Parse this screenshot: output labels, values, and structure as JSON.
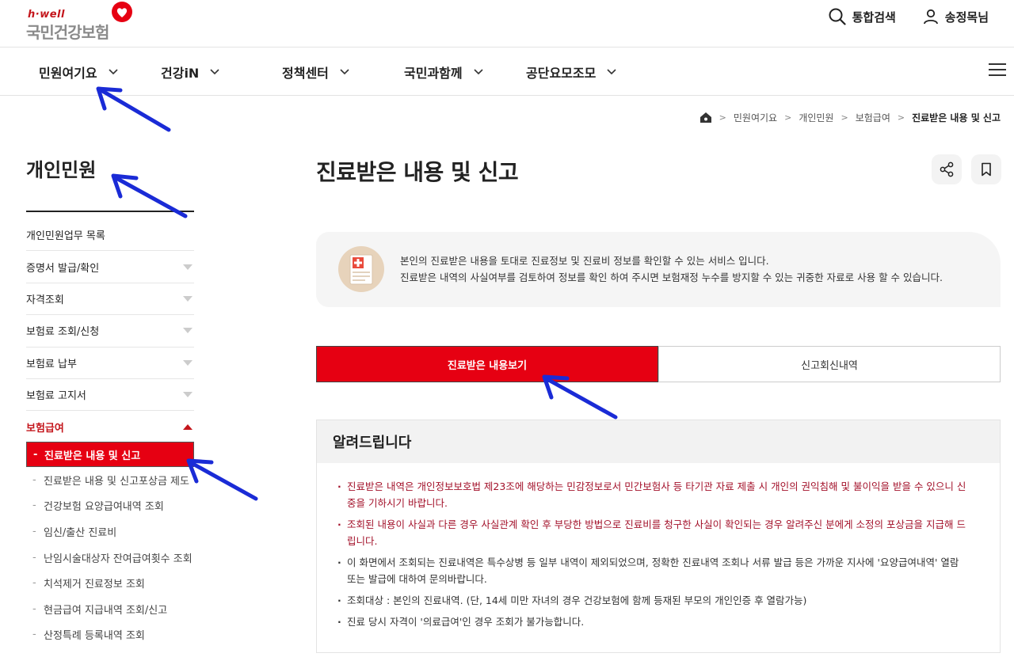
{
  "header": {
    "logo_small": "h·well",
    "logo_main": "국민건강보험",
    "search_label": "통합검색",
    "user_label": "송정목님"
  },
  "nav": {
    "items": [
      {
        "label": "민원여기요"
      },
      {
        "label": "건강iN"
      },
      {
        "label": "정책센터"
      },
      {
        "label": "국민과함께"
      },
      {
        "label": "공단요모조모"
      }
    ]
  },
  "breadcrumb": {
    "items": [
      "민원여기요",
      "개인민원",
      "보험급여"
    ],
    "current": "진료받은 내용 및 신고"
  },
  "sidebar": {
    "title": "개인민원",
    "items": [
      {
        "label": "개인민원업무 목록"
      },
      {
        "label": "증명서 발급/확인"
      },
      {
        "label": "자격조회"
      },
      {
        "label": "보험료 조회/신청"
      },
      {
        "label": "보험료 납부"
      },
      {
        "label": "보험료 고지서"
      },
      {
        "label": "보험급여"
      }
    ],
    "sub_items": [
      {
        "label": "진료받은 내용 및 신고"
      },
      {
        "label": "진료받은 내용 및 신고포상금 제도"
      },
      {
        "label": "건강보험 요양급여내역 조회"
      },
      {
        "label": "임신/출산 진료비"
      },
      {
        "label": "난임시술대상자 잔여급여횟수 조회"
      },
      {
        "label": "치석제거 진료정보 조회"
      },
      {
        "label": "현금급여 지급내역 조회/신고"
      },
      {
        "label": "산정특례 등록내역 조회"
      }
    ]
  },
  "main": {
    "title": "진료받은 내용 및 신고",
    "info_lines": [
      "본인의 진료받은 내용을 토대로 진료정보 및 진료비 정보를 확인할 수 있는 서비스 입니다.",
      "진료받은 내역의 사실여부를 검토하여 정보를 확인 하여 주시면 보험재정 누수를 방지할 수 있는 귀중한 자료로 사용 할 수 있습니다."
    ],
    "tabs": [
      {
        "label": "진료받은 내용보기"
      },
      {
        "label": "신고회신내역"
      }
    ],
    "notice_title": "알려드립니다",
    "notices": [
      "진료받은 내역은 개인정보보호법 제23조에 해당하는 민감정보로서 민간보험사 등 타기관 자료 제출 시 개인의 권익침해 및 불이익을 받을 수 있으니 신중을 기하시기 바랍니다.",
      "조회된 내용이 사실과 다른 경우 사실관계 확인 후 부당한 방법으로 진료비를 청구한 사실이 확인되는 경우 알려주신 분에게 소정의 포상금을 지급해 드립니다.",
      "이 화면에서 조회되는 진료내역은 특수상병 등 일부 내역이 제외되었으며, 정확한 진료내역 조회나 서류 발급 등은 가까운 지사에 '요양급여내역' 열람 또는 발급에 대하여 문의바랍니다.",
      "조회대상 : 본인의 진료내역. (단, 14세 미만 자녀의 경우 건강보험에 함께 등재된 부모의 개인인증 후 열람가능)",
      "진료 당시 자격이 '의료급여'인 경우 조회가 불가능합니다."
    ]
  },
  "colors": {
    "brand_red": "#e60012",
    "dark_red": "#c4161c",
    "notice_red": "#a3112a",
    "arrow_blue": "#1a2bd6"
  }
}
